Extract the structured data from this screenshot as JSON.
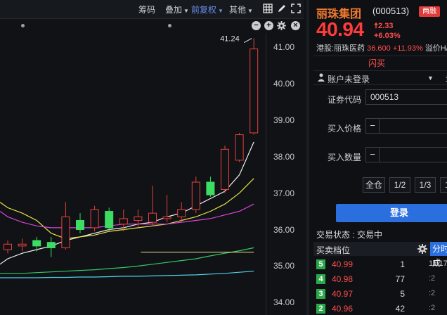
{
  "toolbar": {
    "items": [
      "筹码",
      "叠加",
      "前复权",
      "其他"
    ],
    "active": "前复权"
  },
  "price_axis": {
    "labels": [
      "41.00",
      "40.00",
      "39.00",
      "38.00",
      "37.00",
      "36.00",
      "35.00",
      "34.00"
    ]
  },
  "chart_annotation": "41.24",
  "chart_data": {
    "type": "candlestick",
    "ylim": [
      33.8,
      41.4
    ],
    "up_color": "#e8413c",
    "down_color": "#3ddc62",
    "candles": [
      {
        "o": 35.45,
        "c": 35.6,
        "h": 35.7,
        "l": 35.35
      },
      {
        "o": 35.55,
        "c": 35.6,
        "h": 35.75,
        "l": 35.4
      },
      {
        "o": 35.7,
        "c": 35.55,
        "h": 35.8,
        "l": 35.4
      },
      {
        "o": 35.65,
        "c": 35.5,
        "h": 35.8,
        "l": 35.25
      },
      {
        "o": 35.5,
        "c": 36.35,
        "h": 36.75,
        "l": 35.45
      },
      {
        "o": 36.25,
        "c": 36.0,
        "h": 36.45,
        "l": 35.9
      },
      {
        "o": 36.05,
        "c": 36.55,
        "h": 36.65,
        "l": 35.95
      },
      {
        "o": 36.5,
        "c": 36.05,
        "h": 36.6,
        "l": 35.95
      },
      {
        "o": 36.15,
        "c": 36.3,
        "h": 36.55,
        "l": 35.95
      },
      {
        "o": 36.25,
        "c": 36.35,
        "h": 36.55,
        "l": 36.05
      },
      {
        "o": 36.2,
        "c": 36.45,
        "h": 37.2,
        "l": 36.1
      },
      {
        "o": 36.3,
        "c": 36.35,
        "h": 36.95,
        "l": 36.2
      },
      {
        "o": 36.35,
        "c": 36.55,
        "h": 36.75,
        "l": 36.2
      },
      {
        "o": 36.55,
        "c": 37.3,
        "h": 37.45,
        "l": 36.45
      },
      {
        "o": 37.3,
        "c": 36.95,
        "h": 37.45,
        "l": 36.9
      },
      {
        "o": 37.1,
        "c": 38.2,
        "h": 38.3,
        "l": 37.0
      },
      {
        "o": 37.9,
        "c": 38.6,
        "h": 38.65,
        "l": 37.85
      },
      {
        "o": 38.65,
        "c": 40.95,
        "h": 41.24,
        "l": 38.6
      }
    ],
    "moving_averages": [
      {
        "color": "#f2f2f2",
        "values": [
          35.2,
          35.35,
          35.45,
          35.55,
          35.7,
          35.8,
          35.9,
          36.0,
          36.05,
          36.15,
          36.2,
          36.35,
          36.45,
          36.65,
          36.85,
          37.05,
          37.5,
          38.4
        ]
      },
      {
        "color": "#e8e34a",
        "values": [
          36.6,
          36.45,
          36.25,
          35.9,
          35.75,
          35.8,
          35.85,
          35.95,
          36.0,
          36.05,
          36.1,
          36.15,
          36.25,
          36.35,
          36.5,
          36.7,
          37.0,
          37.4
        ]
      },
      {
        "color": "#d842d8",
        "values": [
          36.35,
          36.2,
          36.1,
          36.05,
          36.05,
          36.05,
          36.05,
          36.1,
          36.15,
          36.15,
          36.15,
          36.15,
          36.2,
          36.25,
          36.3,
          36.4,
          36.5,
          36.7
        ]
      },
      {
        "color": "#35c86a",
        "values": [
          34.8,
          34.8,
          34.82,
          34.84,
          34.86,
          34.88,
          34.9,
          34.93,
          34.96,
          35.0,
          35.05,
          35.1,
          35.15,
          35.2,
          35.28,
          35.35,
          35.42,
          35.5
        ]
      },
      {
        "color": "#4fd2e8",
        "values": [
          34.68,
          34.68,
          34.68,
          34.69,
          34.69,
          34.7,
          34.7,
          34.71,
          34.72,
          34.72,
          34.73,
          34.74,
          34.75,
          34.76,
          34.78,
          34.8,
          34.83,
          34.86
        ]
      }
    ],
    "flat_line": {
      "color": "#f0e68c",
      "value": 35.38
    }
  },
  "quote": {
    "name": "丽珠集团",
    "code": "(000513)",
    "badge": "两融",
    "price": "40.94",
    "change": "2.33",
    "pct": "+6.03%",
    "hk_label": "港股:丽珠医药",
    "hk_value": "36.600 +11.93%",
    "premium_label": "溢价H/A"
  },
  "trade": {
    "tab": "闪买",
    "account": "账户未登录",
    "account_add": "增",
    "code_label": "证券代码",
    "code_value": "000513",
    "price_label": "买入价格",
    "qty_label": "买入数量",
    "minus": "−",
    "qty_buttons": [
      "全仓",
      "1/2",
      "1/3",
      "1/"
    ],
    "login": "登录"
  },
  "status": "交易状态 : 交易中",
  "book": {
    "title": "买卖档位",
    "tab": "分时成",
    "rows": [
      {
        "level": "5",
        "price": "40.99",
        "vol": "1",
        "time": "11:17"
      },
      {
        "level": "4",
        "price": "40.98",
        "vol": "77",
        "time": ":2"
      },
      {
        "level": "3",
        "price": "40.97",
        "vol": "5",
        "time": ":2"
      },
      {
        "level": "2",
        "price": "40.96",
        "vol": "42",
        "time": ":2"
      }
    ]
  }
}
